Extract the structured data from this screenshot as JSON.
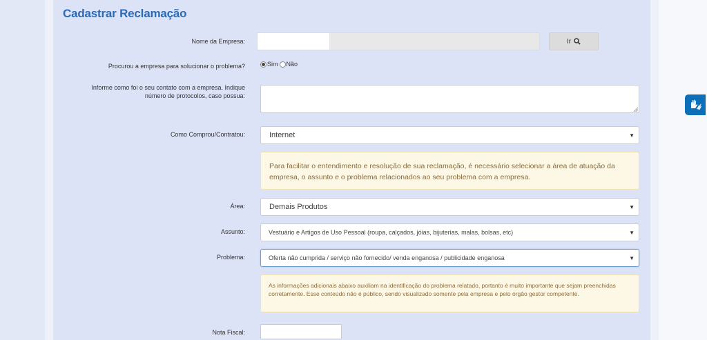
{
  "form": {
    "title": "Cadastrar Reclamação",
    "company_label": "Nome da Empresa:",
    "company_value": "",
    "search_button": "Ir",
    "contacted_label": "Procurou a empresa para solucionar o problema?",
    "radio_yes": "Sim",
    "radio_no": "Não",
    "radio_selected": "Sim",
    "contact_info_label": "Informe como foi o seu contato com a empresa. Indique número de protocolos, caso possua:",
    "contact_info_value": "",
    "purchase_label": "Como Comprou/Contratou:",
    "purchase_value": "Internet",
    "info_box_1": "Para facilitar o entendimento e resolução de sua reclamação, é necessário selecionar a área de atuação da empresa, o assunto e o problema relacionados ao seu problema com a empresa.",
    "area_label": "Área:",
    "area_value": "Demais Produtos",
    "subject_label": "Assunto:",
    "subject_value": "Vestuário e Artigos de Uso Pessoal (roupa, calçados, jóias, bijuterias, malas, bolsas, etc)",
    "problem_label": "Problema:",
    "problem_value": "Oferta não cumprida / serviço não fornecido/ venda enganosa / publicidade enganosa",
    "info_box_2": "As informações adicionais abaixo auxiliam na identificação do problema relatado, portanto é muito importante que sejam preenchidas corretamente. Esse conteúdo não é público, sendo visualizado somente pela empresa e pelo órgão gestor competente.",
    "invoice_label": "Nota Fiscal:",
    "invoice_value": ""
  },
  "icons": {
    "search": "search-icon",
    "caret": "chevron-down-icon",
    "accessibility": "sign-language-hands-icon"
  },
  "colors": {
    "title": "#2c6ab3",
    "info_text": "#8a6d3b",
    "info_bg": "#fcf8e5",
    "accessibility_bg": "#0c6fb8"
  }
}
